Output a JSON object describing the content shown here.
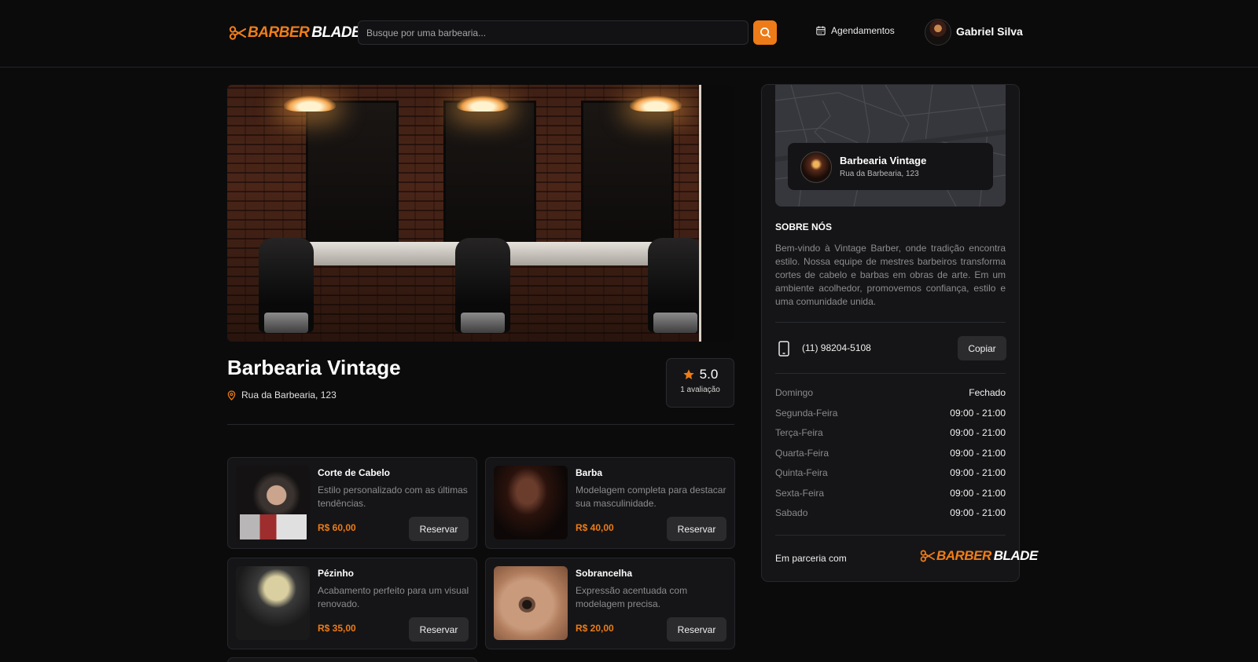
{
  "header": {
    "logo_part1": "BARBER",
    "logo_part2": "BLADE",
    "search_placeholder": "Busque por uma barbearia...",
    "appointments_label": "Agendamentos",
    "user_name": "Gabriel Silva"
  },
  "shop": {
    "name": "Barbearia Vintage",
    "address": "Rua da Barbearia, 123",
    "rating": "5.0",
    "rating_count": "1 avaliação"
  },
  "services": [
    {
      "title": "Corte de Cabelo",
      "description": "Estilo personalizado com as últimas tendências.",
      "price": "R$ 60,00",
      "button": "Reservar"
    },
    {
      "title": "Barba",
      "description": "Modelagem completa para destacar sua masculinidade.",
      "price": "R$ 40,00",
      "button": "Reservar"
    },
    {
      "title": "Pézinho",
      "description": "Acabamento perfeito para um visual renovado.",
      "price": "R$ 35,00",
      "button": "Reservar"
    },
    {
      "title": "Sobrancelha",
      "description": "Expressão acentuada com modelagem precisa.",
      "price": "R$ 20,00",
      "button": "Reservar"
    }
  ],
  "sidebar": {
    "map_card_name": "Barbearia Vintage",
    "map_card_address": "Rua da Barbearia, 123",
    "about_heading": "SOBRE NÓS",
    "about_text": "Bem-vindo à Vintage Barber, onde tradição encontra estilo. Nossa equipe de mestres barbeiros transforma cortes de cabelo e barbas em obras de arte. Em um ambiente acolhedor, promovemos confiança, estilo e uma comunidade unida.",
    "phone": "(11) 98204-5108",
    "copy_label": "Copiar",
    "hours": [
      {
        "day": "Domingo",
        "time": "Fechado"
      },
      {
        "day": "Segunda-Feira",
        "time": "09:00 - 21:00"
      },
      {
        "day": "Terça-Feira",
        "time": "09:00 - 21:00"
      },
      {
        "day": "Quarta-Feira",
        "time": "09:00 - 21:00"
      },
      {
        "day": "Quinta-Feira",
        "time": "09:00 - 21:00"
      },
      {
        "day": "Sexta-Feira",
        "time": "09:00 - 21:00"
      },
      {
        "day": "Sabado",
        "time": "09:00 - 21:00"
      }
    ],
    "partner_label": "Em parceria com"
  },
  "colors": {
    "accent": "#ed7b17",
    "background": "#0b0b0c",
    "card": "#151517"
  },
  "icons": [
    "scissors-icon",
    "search-icon",
    "calendar-icon",
    "map-pin-icon",
    "star-icon",
    "smartphone-icon"
  ]
}
